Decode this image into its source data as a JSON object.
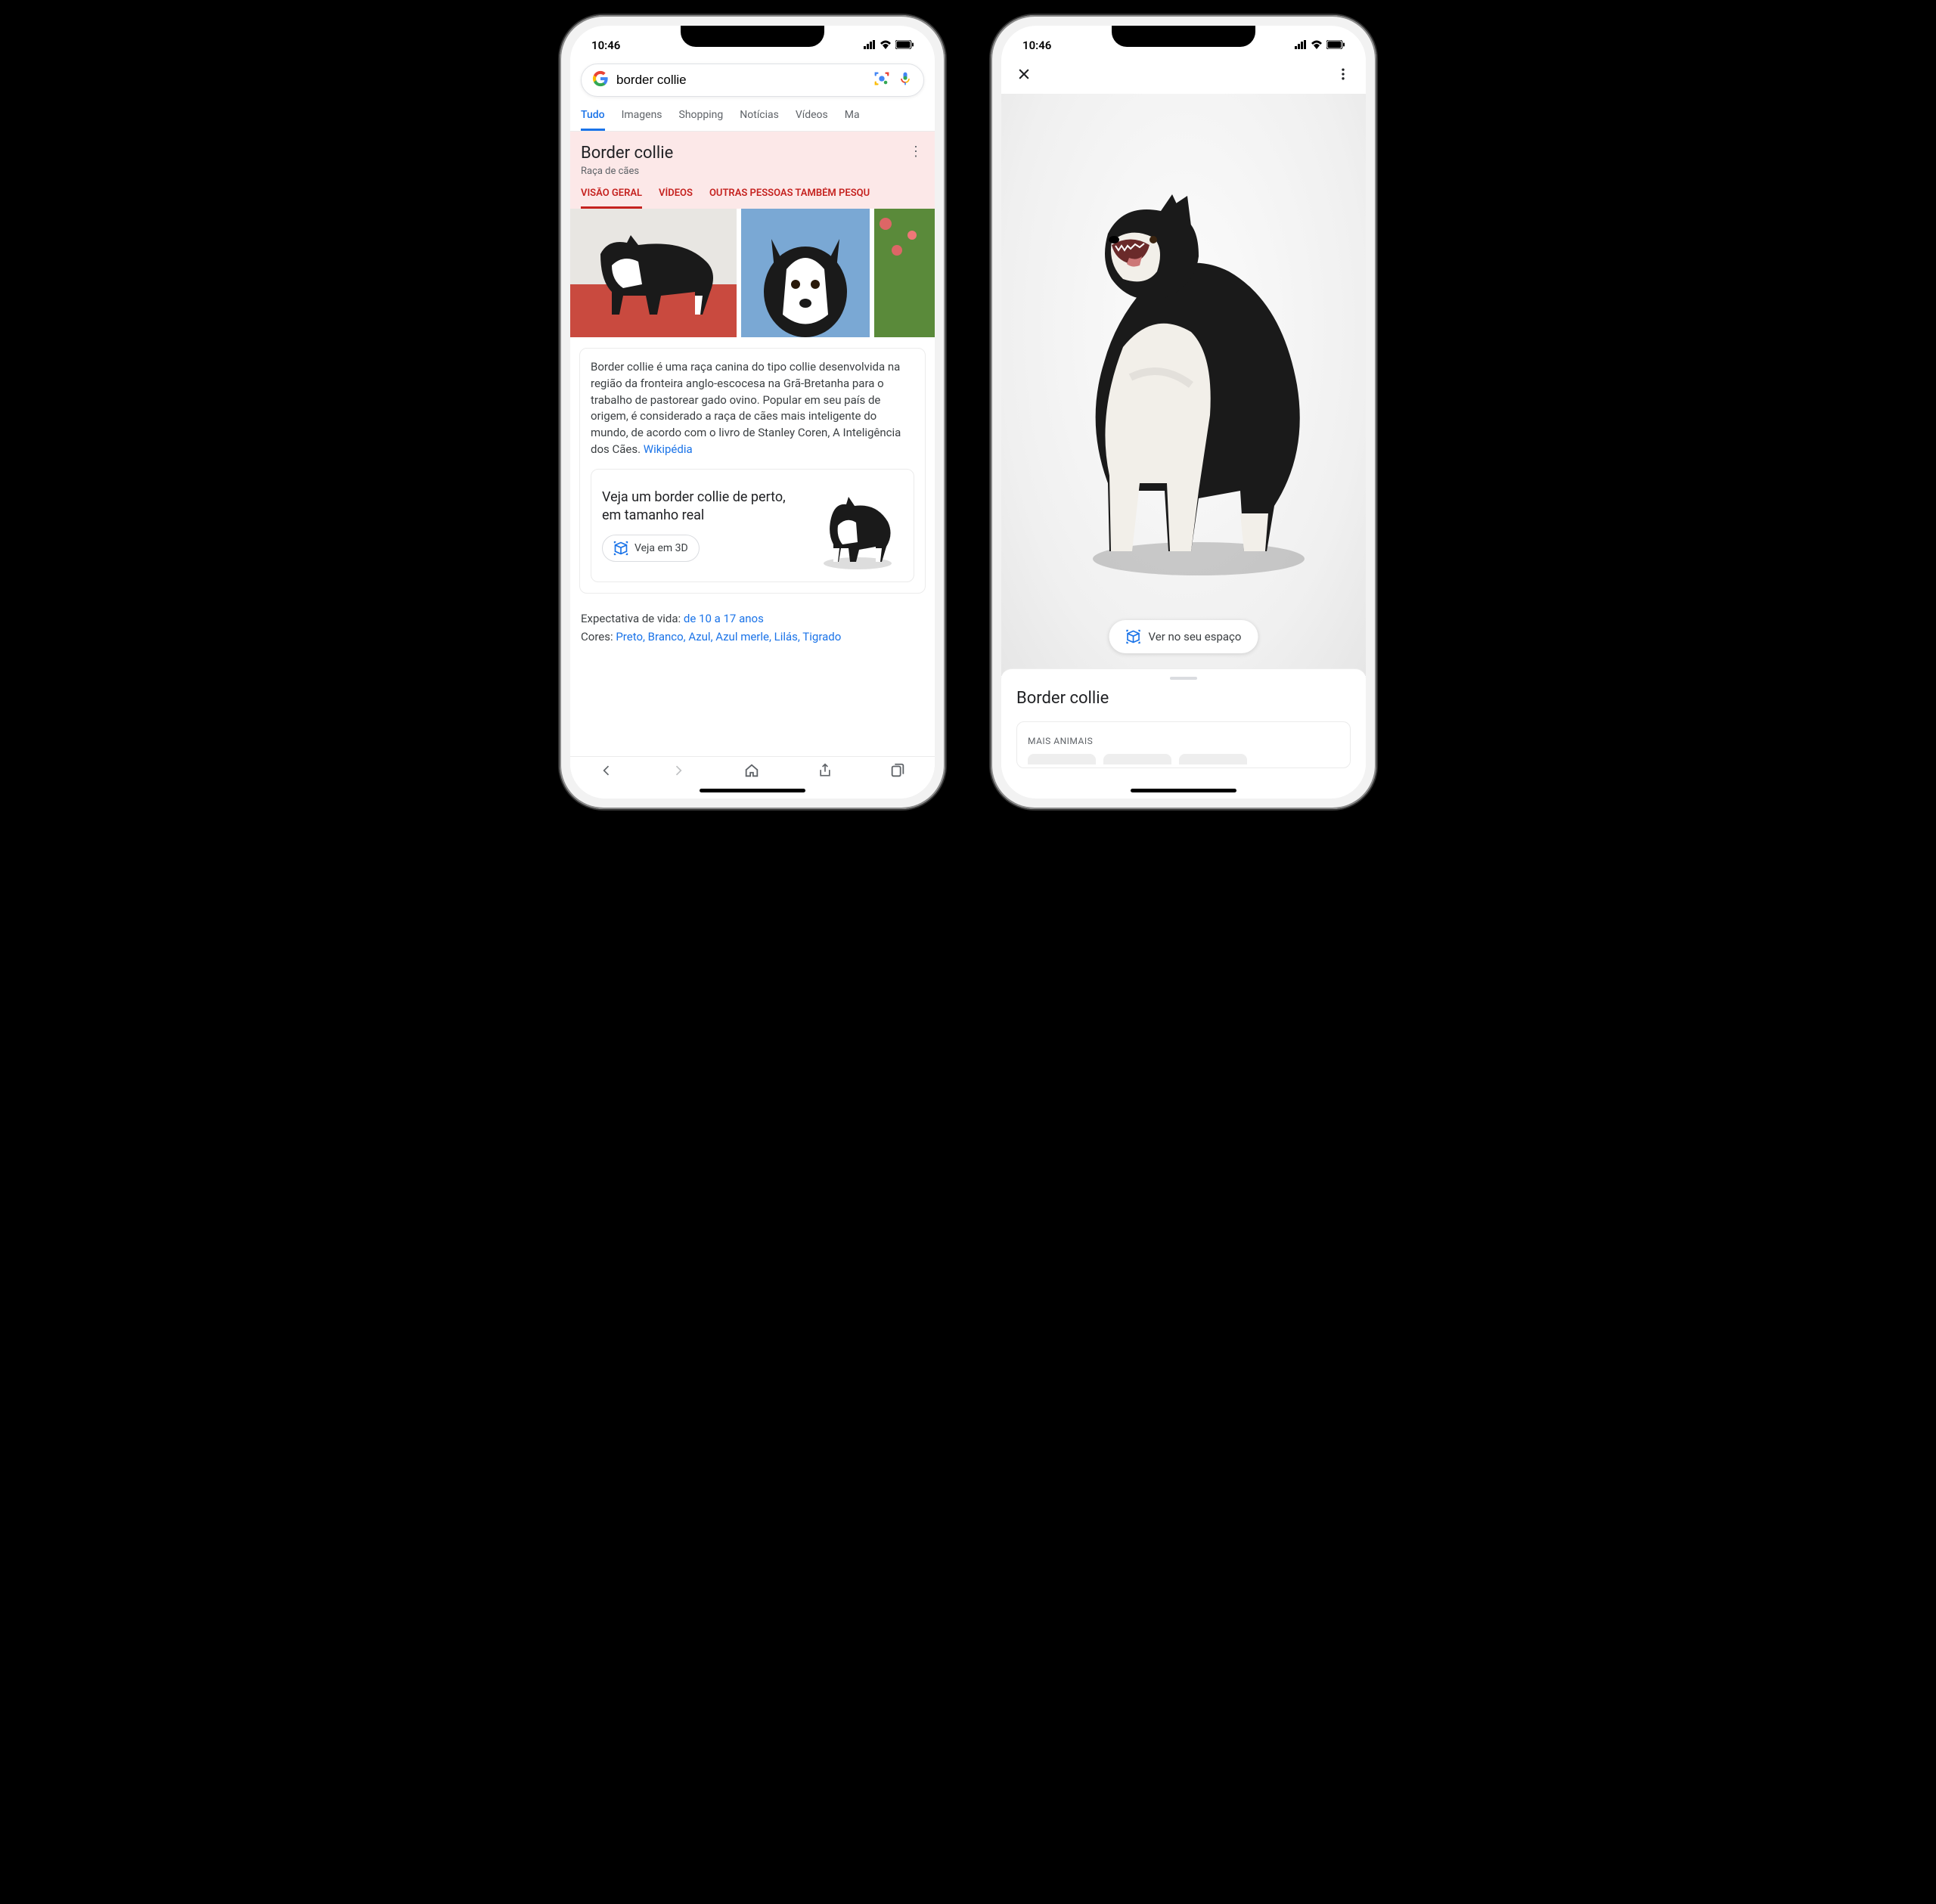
{
  "status": {
    "time": "10:46",
    "signal_icon": "signal-icon",
    "wifi_icon": "wifi-icon",
    "battery_icon": "battery-icon"
  },
  "left": {
    "search": {
      "query": "border collie",
      "lens_icon": "google-lens-icon",
      "mic_icon": "microphone-icon"
    },
    "tabs": [
      "Tudo",
      "Imagens",
      "Shopping",
      "Notícias",
      "Vídeos",
      "Ma"
    ],
    "active_tab_index": 0,
    "knowledge_panel": {
      "title": "Border collie",
      "subtitle": "Raça de cães",
      "tabs": [
        "VISÃO GERAL",
        "VÍDEOS",
        "OUTRAS PESSOAS TAMBÉM PESQU"
      ],
      "active_tab_index": 0
    },
    "summary": {
      "text": "Border collie é uma raça canina do tipo collie desenvolvida na região da fronteira anglo-escocesa na Grã-Bretanha para o trabalho de pastorear gado ovino. Popular em seu país de origem, é considerado a raça de cães mais inteligente do mundo, de acordo com o livro de Stanley Coren, A Inteligência dos Cães. ",
      "source_label": "Wikipédia"
    },
    "ar_card": {
      "headline": "Veja um border collie de perto, em tamanho real",
      "button": "Veja em 3D"
    },
    "facts": [
      {
        "label": "Expectativa de vida:",
        "value": "de 10 a 17 anos"
      },
      {
        "label": "Cores:",
        "value": "Preto, Branco, Azul, Azul merle, Lilás, Tigrado"
      }
    ]
  },
  "right": {
    "close_icon": "close-icon",
    "more_icon": "more-vertical-icon",
    "space_button": "Ver no seu espaço",
    "sheet": {
      "title": "Border collie",
      "section_label": "MAIS ANIMAIS"
    }
  },
  "colors": {
    "google_blue": "#1a73e8",
    "google_red": "#c5221f",
    "text_primary": "#202124",
    "text_secondary": "#5f6368",
    "panel_pink": "#fce8e8"
  }
}
